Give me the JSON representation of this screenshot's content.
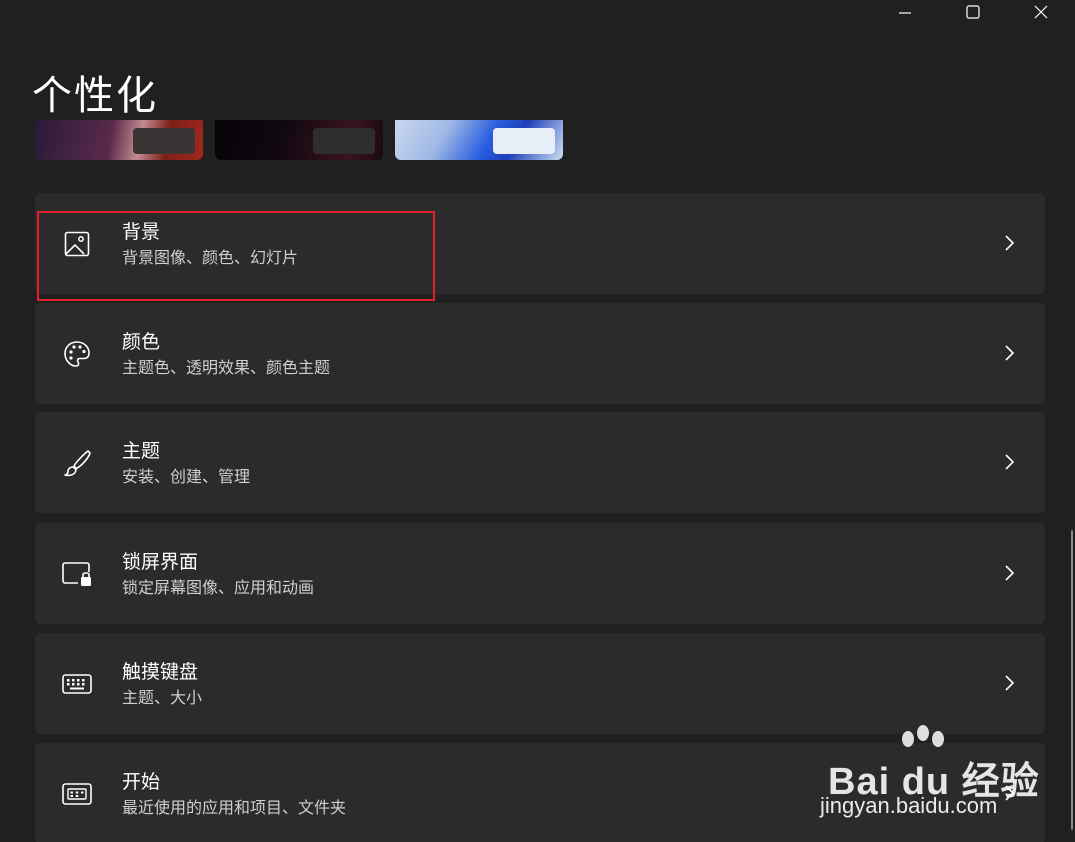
{
  "window": {
    "controls": {
      "minimize": "minimize-icon",
      "maximize": "maximize-icon",
      "close": "close-icon"
    }
  },
  "page": {
    "title": "个性化"
  },
  "settings": [
    {
      "title": "背景",
      "subtitle": "背景图像、颜色、幻灯片",
      "icon": "image-icon"
    },
    {
      "title": "颜色",
      "subtitle": "主题色、透明效果、颜色主题",
      "icon": "palette-icon"
    },
    {
      "title": "主题",
      "subtitle": "安装、创建、管理",
      "icon": "brush-icon"
    },
    {
      "title": "锁屏界面",
      "subtitle": "锁定屏幕图像、应用和动画",
      "icon": "lock-screen-icon"
    },
    {
      "title": "触摸键盘",
      "subtitle": "主题、大小",
      "icon": "keyboard-icon"
    },
    {
      "title": "开始",
      "subtitle": "最近使用的应用和项目、文件夹",
      "icon": "start-icon"
    }
  ],
  "watermark": {
    "logo": "Bai du 经验",
    "url": "jingyan.baidu.com"
  },
  "colors": {
    "background": "#202020",
    "card": "#2b2b2b",
    "highlight": "#e0202a"
  }
}
